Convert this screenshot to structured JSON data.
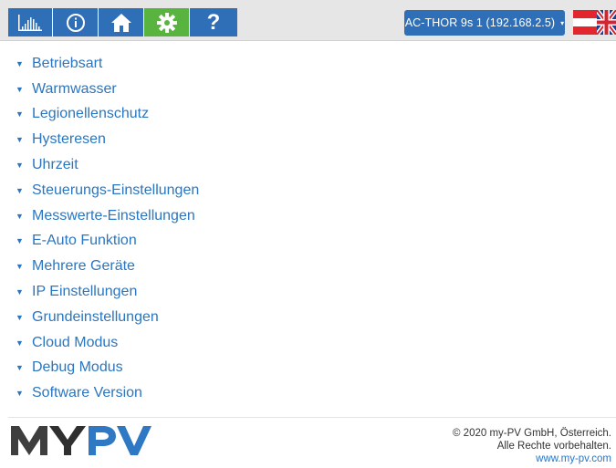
{
  "nav": {
    "buttons": [
      {
        "name": "statistics-icon",
        "label": ""
      },
      {
        "name": "info-icon",
        "label": ""
      },
      {
        "name": "home-icon",
        "label": ""
      },
      {
        "name": "settings-gear-icon",
        "label": ""
      },
      {
        "name": "help-icon",
        "label": "?"
      }
    ],
    "active_color": "#58b43f",
    "button_color": "#2f6fb7"
  },
  "device_selector": {
    "label": "AC-THOR 9s 1 (192.168.2.5)",
    "caret": "▾"
  },
  "languages": [
    "austria-flag-icon",
    "uk-flag-icon"
  ],
  "menu": {
    "bullet": "▼",
    "items": [
      "Betriebsart",
      "Warmwasser",
      "Legionellenschutz",
      "Hysteresen",
      "Uhrzeit",
      "Steuerungs-Einstellungen",
      "Messwerte-Einstellungen",
      "E-Auto Funktion",
      "Mehrere Geräte",
      "IP Einstellungen",
      "Grundeinstellungen",
      "Cloud Modus",
      "Debug Modus",
      "Software Version"
    ]
  },
  "footer": {
    "logo_text": "MYPV",
    "copyright": "© 2020 my-PV GmbH, Österreich.",
    "rights": "Alle Rechte vorbehalten.",
    "link": "www.my-pv.com"
  }
}
